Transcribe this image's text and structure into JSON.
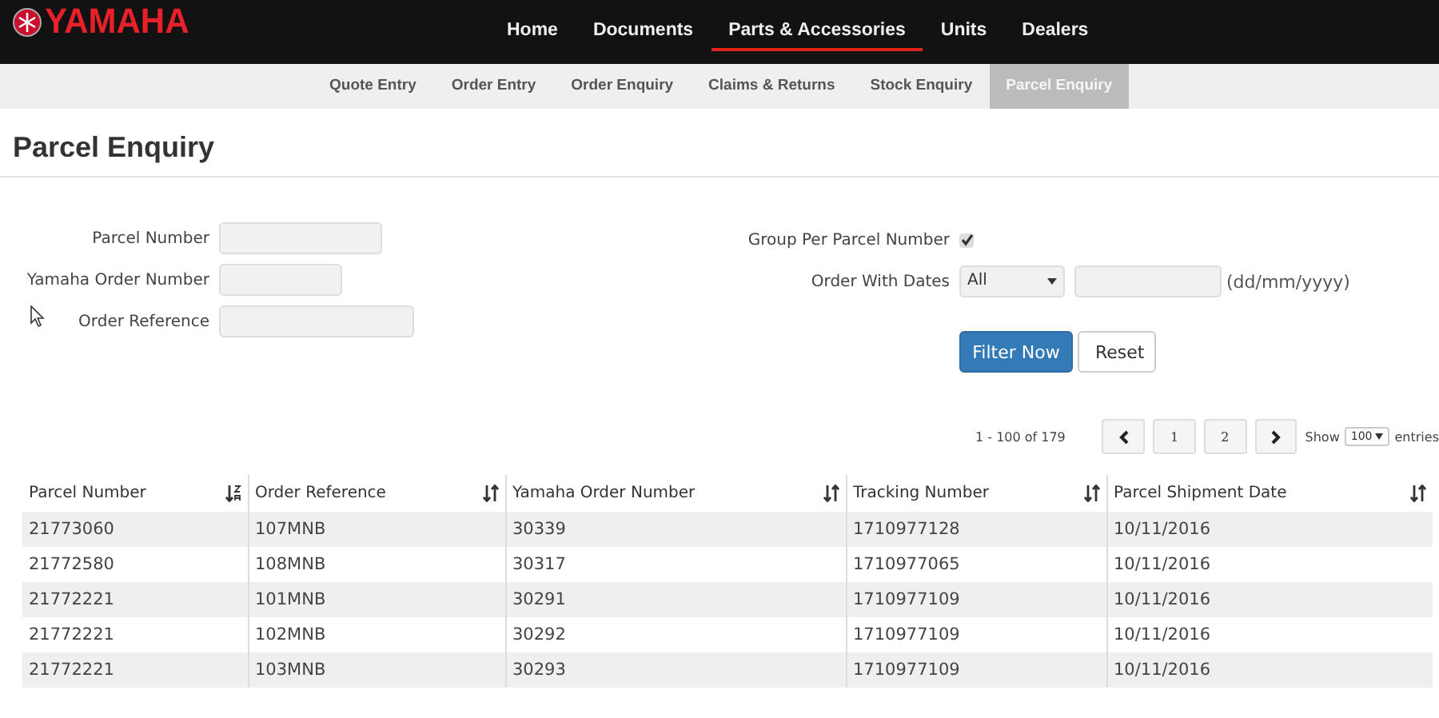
{
  "logo": {
    "text": "YAMAHA"
  },
  "main_nav": [
    {
      "label": "Home",
      "selected": false
    },
    {
      "label": "Documents",
      "selected": false
    },
    {
      "label": "Parts & Accessories",
      "selected": true
    },
    {
      "label": "Units",
      "selected": false
    },
    {
      "label": "Dealers",
      "selected": false
    }
  ],
  "sub_nav": [
    {
      "label": "Quote Entry",
      "selected": false
    },
    {
      "label": "Order Entry",
      "selected": false
    },
    {
      "label": "Order Enquiry",
      "selected": false
    },
    {
      "label": "Claims & Returns",
      "selected": false
    },
    {
      "label": "Stock Enquiry",
      "selected": false
    },
    {
      "label": "Parcel Enquiry",
      "selected": true
    }
  ],
  "page_title": "Parcel Enquiry",
  "filters_left": [
    {
      "label": "Parcel Number"
    },
    {
      "label": "Yamaha Order Number"
    },
    {
      "label": "Order Reference"
    }
  ],
  "group_per_parcel": {
    "label": "Group Per Parcel Number",
    "checked": true
  },
  "order_with_dates": {
    "label": "Order With Dates",
    "select_value": "All",
    "format_hint": "(dd/mm/yyyy)"
  },
  "buttons": [
    {
      "label": "Filter Now",
      "kind": "primary"
    },
    {
      "label": "Reset",
      "kind": "default"
    }
  ],
  "pagination": {
    "summary": "1 - 100 of 179",
    "pages": [
      "1",
      "2"
    ],
    "show_label": "Show",
    "page_size": "100",
    "entries_label": "entries"
  },
  "table": {
    "columns": [
      {
        "label": "Parcel Number",
        "sorted": true
      },
      {
        "label": "Order Reference",
        "sorted": false
      },
      {
        "label": "Yamaha Order Number",
        "sorted": false
      },
      {
        "label": "Tracking Number",
        "sorted": false
      },
      {
        "label": "Parcel Shipment Date",
        "sorted": false
      }
    ],
    "rows": [
      [
        "21773060",
        "107MNB",
        "30339",
        "1710977128",
        "10/11/2016"
      ],
      [
        "21772580",
        "108MNB",
        "30317",
        "1710977065",
        "10/11/2016"
      ],
      [
        "21772221",
        "101MNB",
        "30291",
        "1710977109",
        "10/11/2016"
      ],
      [
        "21772221",
        "102MNB",
        "30292",
        "1710977109",
        "10/11/2016"
      ],
      [
        "21772221",
        "103MNB",
        "30293",
        "1710977109",
        "10/11/2016"
      ]
    ]
  }
}
